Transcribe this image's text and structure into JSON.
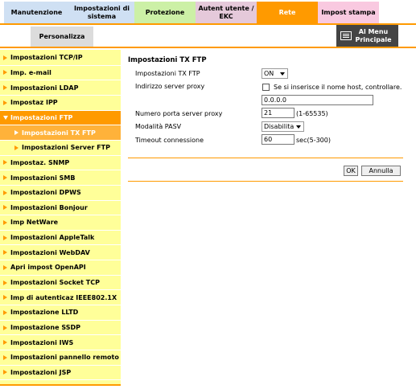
{
  "tabs": {
    "manutenzione": "Manutenzione",
    "impostazioni_sistema": "Impostazioni di sistema",
    "protezione": "Protezione",
    "autent_utente": "Autent utente / EKC",
    "rete": "Rete",
    "impost_stampa": "Impost stampa",
    "personalizza": "Personalizza",
    "main_menu": "Al Menu Principale"
  },
  "colors": {
    "accent": "#ff9a00",
    "sidebar_bg": "#ffff99"
  },
  "sidebar": {
    "items": [
      {
        "label": "Impostazioni TCP/IP"
      },
      {
        "label": "Imp. e-mail"
      },
      {
        "label": "Impostazioni LDAP"
      },
      {
        "label": "Impostaz IPP"
      },
      {
        "label": "Impostazioni FTP"
      },
      {
        "label": "Impostazioni TX FTP"
      },
      {
        "label": "Impostazioni Server FTP"
      },
      {
        "label": "Impostaz. SNMP"
      },
      {
        "label": "Impostazioni SMB"
      },
      {
        "label": "Impostazioni DPWS"
      },
      {
        "label": "Impostazioni Bonjour"
      },
      {
        "label": "Imp NetWare"
      },
      {
        "label": "Impostazioni AppleTalk"
      },
      {
        "label": "Impostazioni WebDAV"
      },
      {
        "label": "Apri impost OpenAPI"
      },
      {
        "label": "Impostazioni Socket TCP"
      },
      {
        "label": "Imp di autenticaz IEEE802.1X"
      },
      {
        "label": "Impostazione LLTD"
      },
      {
        "label": "Impostazione SSDP"
      },
      {
        "label": "Impostazioni IWS"
      },
      {
        "label": "Impostazioni pannello remoto"
      },
      {
        "label": "Impostazioni JSP"
      }
    ]
  },
  "form": {
    "title": "Impostazioni TX FTP",
    "tx_ftp_label": "Impostazioni TX FTP",
    "tx_ftp_value": "ON",
    "proxy_label": "Indirizzo server proxy",
    "proxy_checkbox_label": "Se si inserisce il nome host, controllare.",
    "proxy_value": "0.0.0.0",
    "port_label": "Numero porta server proxy",
    "port_value": "21",
    "port_hint": "(1-65535)",
    "pasv_label": "Modalità PASV",
    "pasv_value": "Disabilita",
    "timeout_label": "Timeout connessione",
    "timeout_value": "60",
    "timeout_hint": "sec(5-300)",
    "ok_label": "OK",
    "cancel_label": "Annulla"
  }
}
